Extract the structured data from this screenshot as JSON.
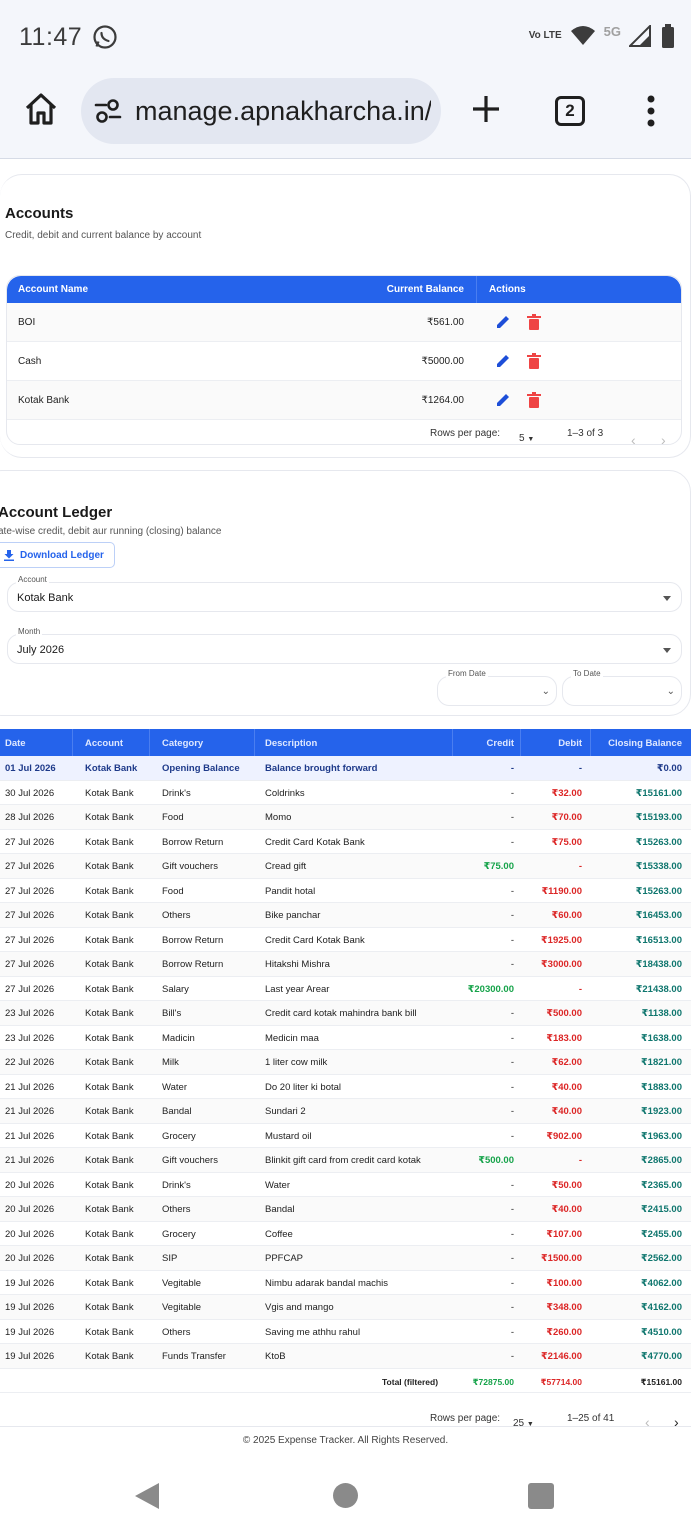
{
  "status_bar": {
    "time": "11:47",
    "volte": "Vo LTE",
    "network": "5G"
  },
  "browser": {
    "url": "manage.apnakharcha.in/",
    "tab_count": "2"
  },
  "accounts": {
    "title": "Accounts",
    "subtitle": "Credit, debit and current balance by account",
    "headers": {
      "name": "Account Name",
      "balance": "Current Balance",
      "actions": "Actions"
    },
    "rows": [
      {
        "name": "BOI",
        "balance": "₹561.00"
      },
      {
        "name": "Cash",
        "balance": "₹5000.00"
      },
      {
        "name": "Kotak Bank",
        "balance": "₹1264.00"
      }
    ],
    "rows_per_page_label": "Rows per page:",
    "rows_per_page": "5",
    "range": "1–3 of 3"
  },
  "ledger": {
    "title": "Account Ledger",
    "subtitle": "ate-wise credit, debit aur running (closing) balance",
    "download_label": "Download Ledger",
    "account_label": "Account",
    "account_value": "Kotak Bank",
    "month_label": "Month",
    "month_value": "July 2026",
    "from_label": "From Date",
    "to_label": "To Date",
    "headers": {
      "date": "Date",
      "account": "Account",
      "category": "Category",
      "description": "Description",
      "credit": "Credit",
      "debit": "Debit",
      "closing": "Closing Balance"
    },
    "rows": [
      {
        "date": "01 Jul 2026",
        "account": "Kotak Bank",
        "category": "Opening Balance",
        "description": "Balance brought forward",
        "credit": "-",
        "debit": "-",
        "closing": "₹0.00"
      },
      {
        "date": "30 Jul 2026",
        "account": "Kotak Bank",
        "category": "Drink's",
        "description": "Coldrinks",
        "credit": "-",
        "debit": "₹32.00",
        "closing": "₹15161.00"
      },
      {
        "date": "28 Jul 2026",
        "account": "Kotak Bank",
        "category": "Food",
        "description": "Momo",
        "credit": "-",
        "debit": "₹70.00",
        "closing": "₹15193.00"
      },
      {
        "date": "27 Jul 2026",
        "account": "Kotak Bank",
        "category": "Borrow Return",
        "description": "Credit Card Kotak Bank",
        "credit": "-",
        "debit": "₹75.00",
        "closing": "₹15263.00"
      },
      {
        "date": "27 Jul 2026",
        "account": "Kotak Bank",
        "category": "Gift vouchers",
        "description": "Cread gift",
        "credit": "₹75.00",
        "debit": "-",
        "closing": "₹15338.00"
      },
      {
        "date": "27 Jul 2026",
        "account": "Kotak Bank",
        "category": "Food",
        "description": "Pandit hotal",
        "credit": "-",
        "debit": "₹1190.00",
        "closing": "₹15263.00"
      },
      {
        "date": "27 Jul 2026",
        "account": "Kotak Bank",
        "category": "Others",
        "description": "Bike panchar",
        "credit": "-",
        "debit": "₹60.00",
        "closing": "₹16453.00"
      },
      {
        "date": "27 Jul 2026",
        "account": "Kotak Bank",
        "category": "Borrow Return",
        "description": "Credit Card Kotak Bank",
        "credit": "-",
        "debit": "₹1925.00",
        "closing": "₹16513.00"
      },
      {
        "date": "27 Jul 2026",
        "account": "Kotak Bank",
        "category": "Borrow Return",
        "description": "Hitakshi Mishra",
        "credit": "-",
        "debit": "₹3000.00",
        "closing": "₹18438.00"
      },
      {
        "date": "27 Jul 2026",
        "account": "Kotak Bank",
        "category": "Salary",
        "description": "Last year Arear",
        "credit": "₹20300.00",
        "debit": "-",
        "closing": "₹21438.00"
      },
      {
        "date": "23 Jul 2026",
        "account": "Kotak Bank",
        "category": "Bill's",
        "description": "Credit card kotak mahindra bank bill",
        "credit": "-",
        "debit": "₹500.00",
        "closing": "₹1138.00"
      },
      {
        "date": "23 Jul 2026",
        "account": "Kotak Bank",
        "category": "Madicin",
        "description": "Medicin maa",
        "credit": "-",
        "debit": "₹183.00",
        "closing": "₹1638.00"
      },
      {
        "date": "22 Jul 2026",
        "account": "Kotak Bank",
        "category": "Milk",
        "description": "1 liter cow milk",
        "credit": "-",
        "debit": "₹62.00",
        "closing": "₹1821.00"
      },
      {
        "date": "21 Jul 2026",
        "account": "Kotak Bank",
        "category": "Water",
        "description": "Do 20 liter ki botal",
        "credit": "-",
        "debit": "₹40.00",
        "closing": "₹1883.00"
      },
      {
        "date": "21 Jul 2026",
        "account": "Kotak Bank",
        "category": "Bandal",
        "description": "Sundari 2",
        "credit": "-",
        "debit": "₹40.00",
        "closing": "₹1923.00"
      },
      {
        "date": "21 Jul 2026",
        "account": "Kotak Bank",
        "category": "Grocery",
        "description": "Mustard oil",
        "credit": "-",
        "debit": "₹902.00",
        "closing": "₹1963.00"
      },
      {
        "date": "21 Jul 2026",
        "account": "Kotak Bank",
        "category": "Gift vouchers",
        "description": "Blinkit gift card from credit card kotak",
        "credit": "₹500.00",
        "debit": "-",
        "closing": "₹2865.00"
      },
      {
        "date": "20 Jul 2026",
        "account": "Kotak Bank",
        "category": "Drink's",
        "description": "Water",
        "credit": "-",
        "debit": "₹50.00",
        "closing": "₹2365.00"
      },
      {
        "date": "20 Jul 2026",
        "account": "Kotak Bank",
        "category": "Others",
        "description": "Bandal",
        "credit": "-",
        "debit": "₹40.00",
        "closing": "₹2415.00"
      },
      {
        "date": "20 Jul 2026",
        "account": "Kotak Bank",
        "category": "Grocery",
        "description": "Coffee",
        "credit": "-",
        "debit": "₹107.00",
        "closing": "₹2455.00"
      },
      {
        "date": "20 Jul 2026",
        "account": "Kotak Bank",
        "category": "SIP",
        "description": "PPFCAP",
        "credit": "-",
        "debit": "₹1500.00",
        "closing": "₹2562.00"
      },
      {
        "date": "19 Jul 2026",
        "account": "Kotak Bank",
        "category": "Vegitable",
        "description": "Nimbu adarak bandal machis",
        "credit": "-",
        "debit": "₹100.00",
        "closing": "₹4062.00"
      },
      {
        "date": "19 Jul 2026",
        "account": "Kotak Bank",
        "category": "Vegitable",
        "description": "Vgis and mango",
        "credit": "-",
        "debit": "₹348.00",
        "closing": "₹4162.00"
      },
      {
        "date": "19 Jul 2026",
        "account": "Kotak Bank",
        "category": "Others",
        "description": "Saving me athhu rahul",
        "credit": "-",
        "debit": "₹260.00",
        "closing": "₹4510.00"
      },
      {
        "date": "19 Jul 2026",
        "account": "Kotak Bank",
        "category": "Funds Transfer",
        "description": "KtoB",
        "credit": "-",
        "debit": "₹2146.00",
        "closing": "₹4770.00"
      }
    ],
    "total": {
      "label": "Total (filtered)",
      "credit": "₹72875.00",
      "debit": "₹57714.00",
      "closing": "₹15161.00"
    },
    "rows_per_page_label": "Rows per page:",
    "rows_per_page": "25",
    "range": "1–25 of 41"
  },
  "footer": {
    "copyright": "© 2025 Expense Tracker. All Rights Reserved."
  },
  "colors": {
    "accent": "#2563eb",
    "credit": "#16a34a",
    "debit": "#dc2626",
    "closing": "#0f766e"
  }
}
